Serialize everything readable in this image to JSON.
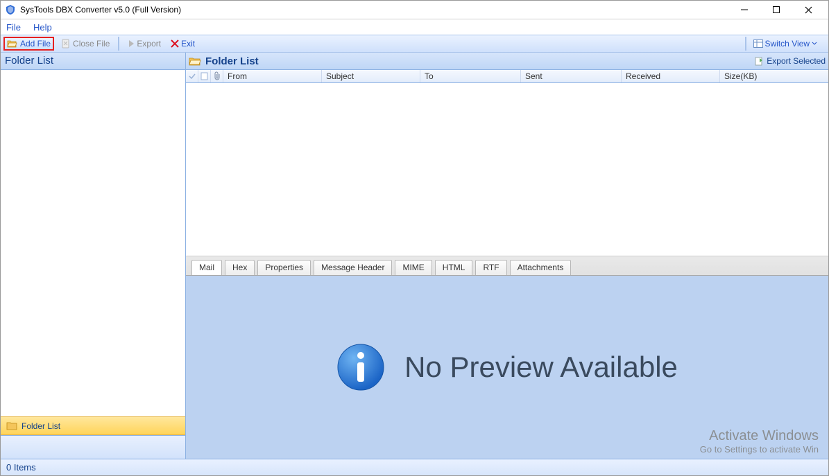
{
  "titlebar": {
    "title": "SysTools DBX Converter v5.0 (Full Version)"
  },
  "menubar": {
    "file": "File",
    "help": "Help"
  },
  "toolbar": {
    "add_file": "Add File",
    "close_file": "Close File",
    "export": "Export",
    "exit": "Exit",
    "switch_view": "Switch View"
  },
  "sidebar": {
    "header": "Folder List",
    "button_label": "Folder List"
  },
  "folderlist": {
    "header_title": "Folder List",
    "export_selected": "Export Selected",
    "columns": {
      "from": "From",
      "subject": "Subject",
      "to": "To",
      "sent": "Sent",
      "received": "Received",
      "size": "Size(KB)"
    }
  },
  "tabs": {
    "mail": "Mail",
    "hex": "Hex",
    "properties": "Properties",
    "message_header": "Message Header",
    "mime": "MIME",
    "html": "HTML",
    "rtf": "RTF",
    "attachments": "Attachments"
  },
  "preview": {
    "text": "No Preview Available"
  },
  "watermark": {
    "line1": "Activate Windows",
    "line2": "Go to Settings to activate Win"
  },
  "statusbar": {
    "items": "0 Items"
  }
}
